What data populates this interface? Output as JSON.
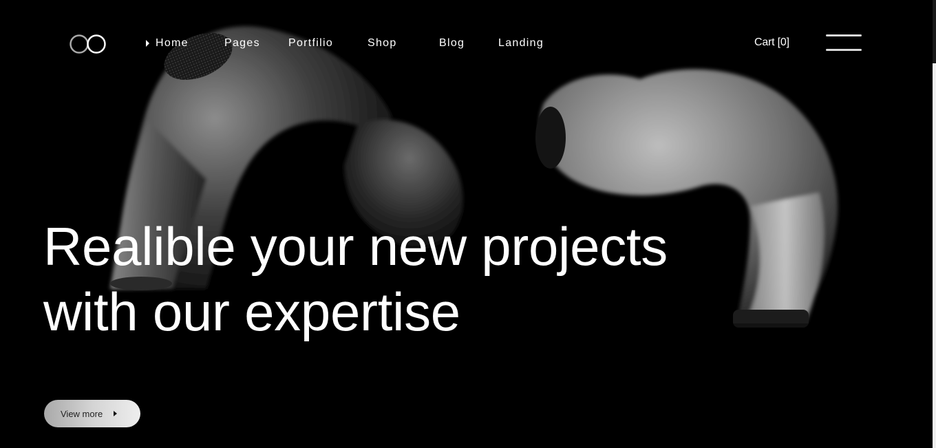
{
  "nav": {
    "items": [
      {
        "label": "Home",
        "active": true
      },
      {
        "label": "Pages",
        "active": false
      },
      {
        "label": "Portfilio",
        "active": false
      },
      {
        "label": "Shop",
        "active": false
      },
      {
        "label": "Blog",
        "active": false
      },
      {
        "label": "Landing",
        "active": false
      }
    ]
  },
  "header": {
    "logo_icon": "double-ring-logo",
    "cart_label": "Cart [0]",
    "menu_icon": "hamburger-icon"
  },
  "hero": {
    "headline_line1": "Realible your new projects",
    "headline_line2": "with our expertise",
    "cta_label": "View more",
    "background_image": "black-and-white-earbuds-photo"
  },
  "colors": {
    "background": "#000000",
    "text": "#ffffff",
    "button_start": "#a9a9a9",
    "button_end": "#eeeeee"
  }
}
